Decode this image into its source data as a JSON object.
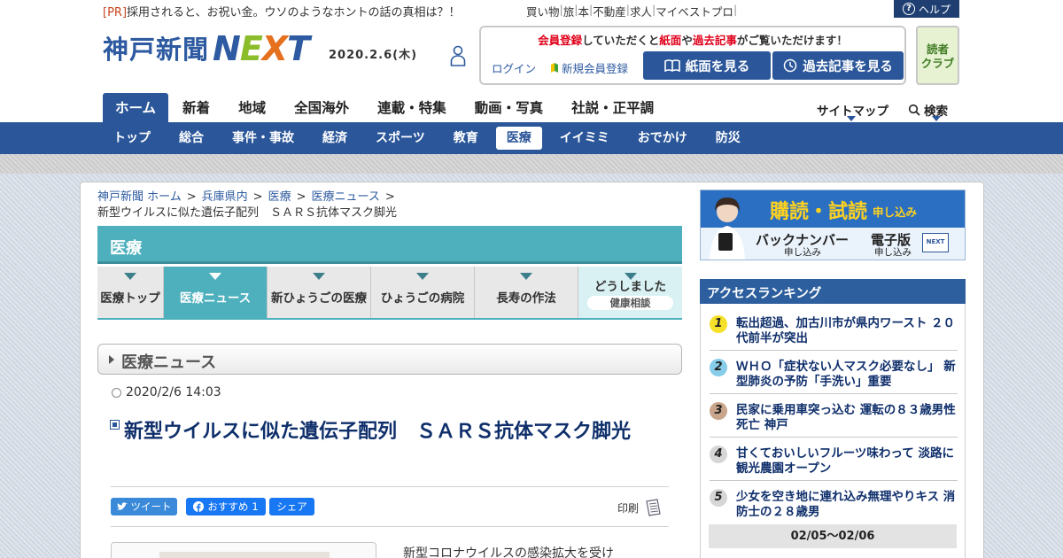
{
  "top": {
    "pr_tag": "[PR]",
    "pr_text": "採用されると、お祝い金。ウソのようなホントの話の真相は？！",
    "links": [
      "買い物",
      "旅",
      "本",
      "不動産",
      "求人",
      "マイベストプロ"
    ],
    "help": "ヘルプ"
  },
  "header": {
    "logo_kobe": "神戸新聞",
    "logo_next": [
      "N",
      "E",
      "X",
      "T"
    ],
    "date": "2020.2.6(木)",
    "member_msg": [
      "会員登録",
      "していただくと",
      "紙面",
      "や",
      "過去記事",
      "がご覧いただけます！"
    ],
    "login": "ログイン",
    "new_register": "新規会員登録",
    "btn_paper": "紙面を見る",
    "btn_past": "過去記事を見る",
    "reader_club": [
      "読者",
      "クラブ"
    ]
  },
  "mainnav": {
    "items": [
      "ホーム",
      "新着",
      "地域",
      "全国海外",
      "連載・特集",
      "動画・写真",
      "社説・正平調"
    ],
    "sitemap": "サイトマップ",
    "search": "検索"
  },
  "subnav": {
    "items": [
      "トップ",
      "総合",
      "事件・事故",
      "経済",
      "スポーツ",
      "教育",
      "医療",
      "イイミミ",
      "おでかけ",
      "防災"
    ]
  },
  "breadcrumb": {
    "items": [
      "神戸新聞 ホーム",
      "兵庫県内",
      "医療",
      "医療ニュース"
    ],
    "current": "新型ウイルスに似た遺伝子配列　ＳＡＲＳ抗体マスク脚光"
  },
  "section": {
    "title": "医療",
    "tabs": [
      "医療トップ",
      "医療ニュース",
      "新ひょうごの医療",
      "ひょうごの病院",
      "長寿の作法",
      "どうしました",
      "健康相談"
    ]
  },
  "article": {
    "category": "医療ニュース",
    "timestamp": "2020/2/6 14:03",
    "headline": "新型ウイルスに似た遺伝子配列　ＳＡＲＳ抗体マスク脚光",
    "tweet": "ツイート",
    "fb_like": "おすすめ",
    "fb_count": "1",
    "fb_share": "シェア",
    "print": "印刷",
    "body_start": "新型コロナウイルスの感染拡大を受け"
  },
  "sidebar": {
    "promo_main": "購読・試読",
    "promo_sub": "申し込み",
    "promo_back": "バックナンバー",
    "promo_back_sub": "申し込み",
    "promo_ed": "電子版",
    "promo_ed_sub": "申し込み",
    "promo_badge": "NEXT",
    "ranking_title": "アクセスランキング",
    "ranking": [
      {
        "rank": "1",
        "text": "転出超過、加古川市が県内ワースト ２０代前半が突出",
        "color": "#f5e02a"
      },
      {
        "rank": "2",
        "text": "ＷＨＯ「症状ない人マスク必要なし」 新型肺炎の予防「手洗い」重要",
        "color": "#87cdea"
      },
      {
        "rank": "3",
        "text": "民家に乗用車突っ込む 運転の８３歳男性死亡 神戸",
        "color": "#c9a58b"
      },
      {
        "rank": "4",
        "text": "甘くておいしいフルーツ味わって 淡路に観光農園オープン",
        "color": "#d6d6d6"
      },
      {
        "rank": "5",
        "text": "少女を空き地に連れ込み無理やりキス 消防士の２８歳男",
        "color": "#d6d6d6"
      }
    ],
    "ranking_period": "02/05～02/06"
  }
}
